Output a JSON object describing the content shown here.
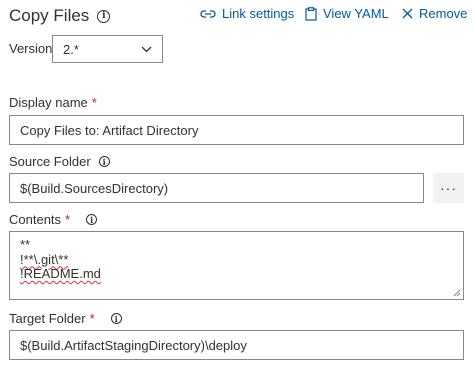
{
  "header": {
    "title": "Copy Files",
    "actions": {
      "link_settings": "Link settings",
      "view_yaml": "View YAML",
      "remove": "Remove"
    }
  },
  "version": {
    "label": "Version",
    "value": "2.*"
  },
  "display_name": {
    "label": "Display name",
    "required_mark": "*",
    "value": "Copy Files to: Artifact Directory"
  },
  "source_folder": {
    "label": "Source Folder",
    "value": "$(Build.SourcesDirectory)",
    "browse_label": "···"
  },
  "contents": {
    "label": "Contents",
    "required_mark": "*",
    "lines": [
      "**",
      "!**\\.git\\**",
      "!README.md"
    ]
  },
  "target_folder": {
    "label": "Target Folder",
    "required_mark": "*",
    "value": "$(Build.ArtifactStagingDirectory)\\deploy"
  },
  "colors": {
    "accent": "#005a9e",
    "required": "#a4262c",
    "border": "#8a8886"
  }
}
